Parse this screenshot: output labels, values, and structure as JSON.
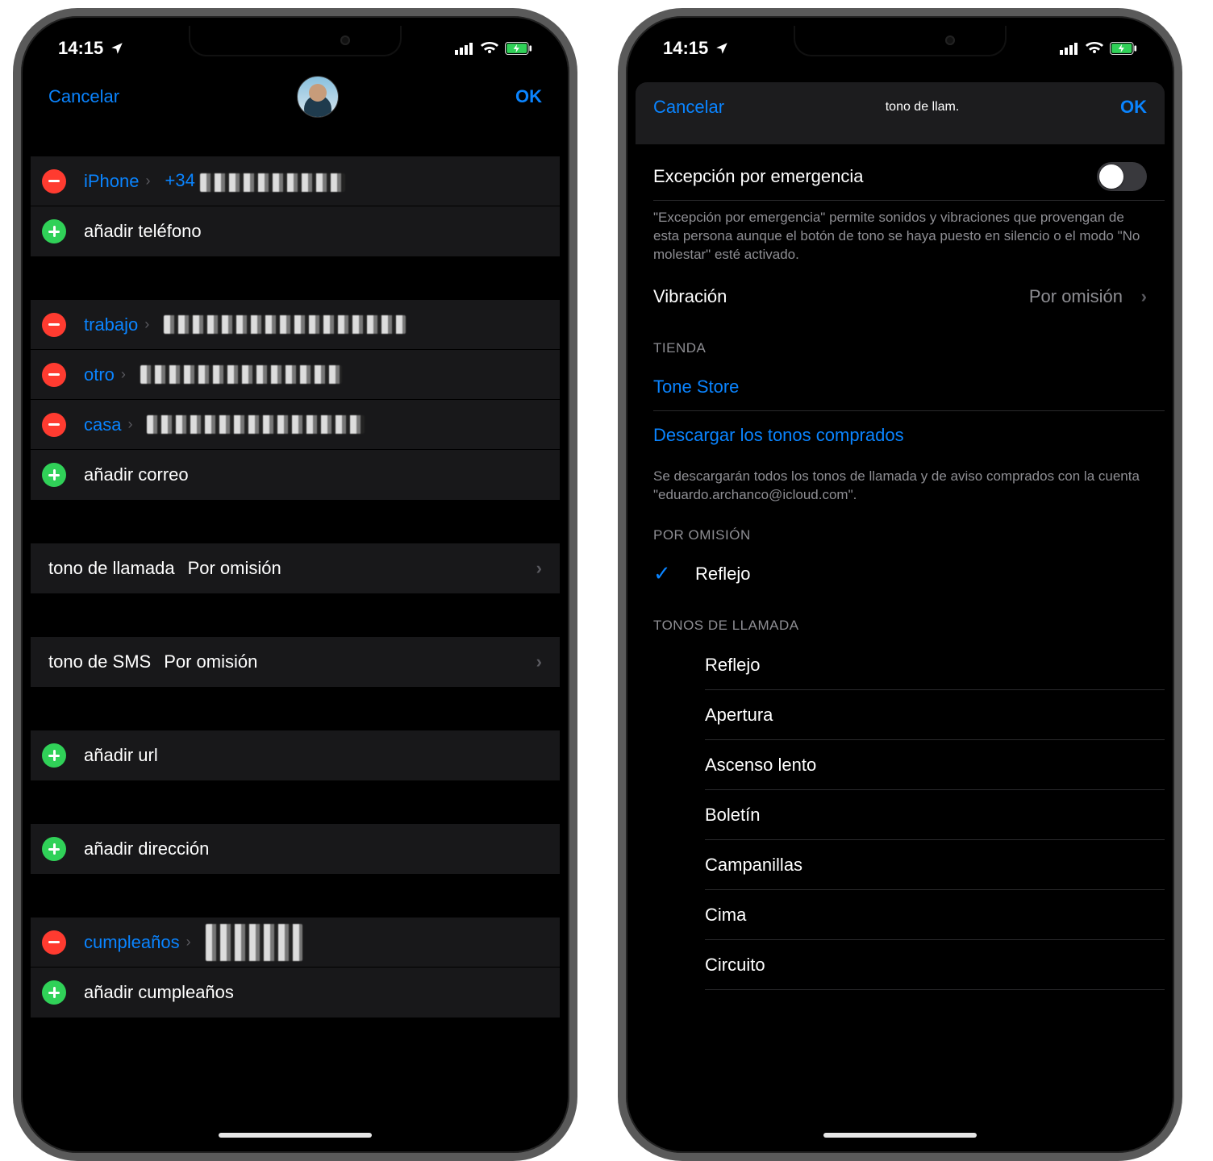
{
  "status": {
    "time": "14:15"
  },
  "phone1": {
    "cancel": "Cancelar",
    "ok": "OK",
    "phone_section": {
      "row": {
        "type": "iPhone",
        "value": "+34 ▮▮▮ ▮▮▮ ▮▮▮"
      },
      "add": "añadir teléfono"
    },
    "email_section": {
      "rows": [
        {
          "type": "trabajo",
          "value": "▮▮▮▮▮▮▮▮▮▮▮▮▮▮▮▮▮▮"
        },
        {
          "type": "otro",
          "value": "▮▮▮▮▮▮▮▮▮▮▮▮▮▮"
        },
        {
          "type": "casa",
          "value": "▮▮▮▮▮▮▮▮▮▮▮▮▮▮▮▮"
        }
      ],
      "add": "añadir correo"
    },
    "ringtone": {
      "label": "tono de llamada",
      "value": "Por omisión"
    },
    "sms": {
      "label": "tono de SMS",
      "value": "Por omisión"
    },
    "add_url": "añadir url",
    "add_address": "añadir dirección",
    "birthday": {
      "type": "cumpleaños",
      "value": "▮▮ ▮▮▮ ▮▮▮▮",
      "add": "añadir cumpleaños"
    }
  },
  "phone2": {
    "cancel": "Cancelar",
    "title": "tono de llam.",
    "ok": "OK",
    "emergency": {
      "label": "Excepción por emergencia",
      "on": false
    },
    "emergency_footer": "\"Excepción por emergencia\" permite sonidos y vibraciones que provengan de esta persona aunque el botón de tono se haya puesto en silencio o el modo \"No molestar\" esté activado.",
    "vibration": {
      "label": "Vibración",
      "value": "Por omisión"
    },
    "store_header": "TIENDA",
    "store_link": "Tone Store",
    "download_link": "Descargar los tonos comprados",
    "download_footer": "Se descargarán todos los tonos de llamada y de aviso comprados con la cuenta \"eduardo.archanco@icloud.com\".",
    "default_header": "POR OMISIÓN",
    "default_tone": "Reflejo",
    "ringtones_header": "TONOS DE LLAMADA",
    "ringtones": [
      "Reflejo",
      "Apertura",
      "Ascenso lento",
      "Boletín",
      "Campanillas",
      "Cima",
      "Circuito"
    ]
  }
}
